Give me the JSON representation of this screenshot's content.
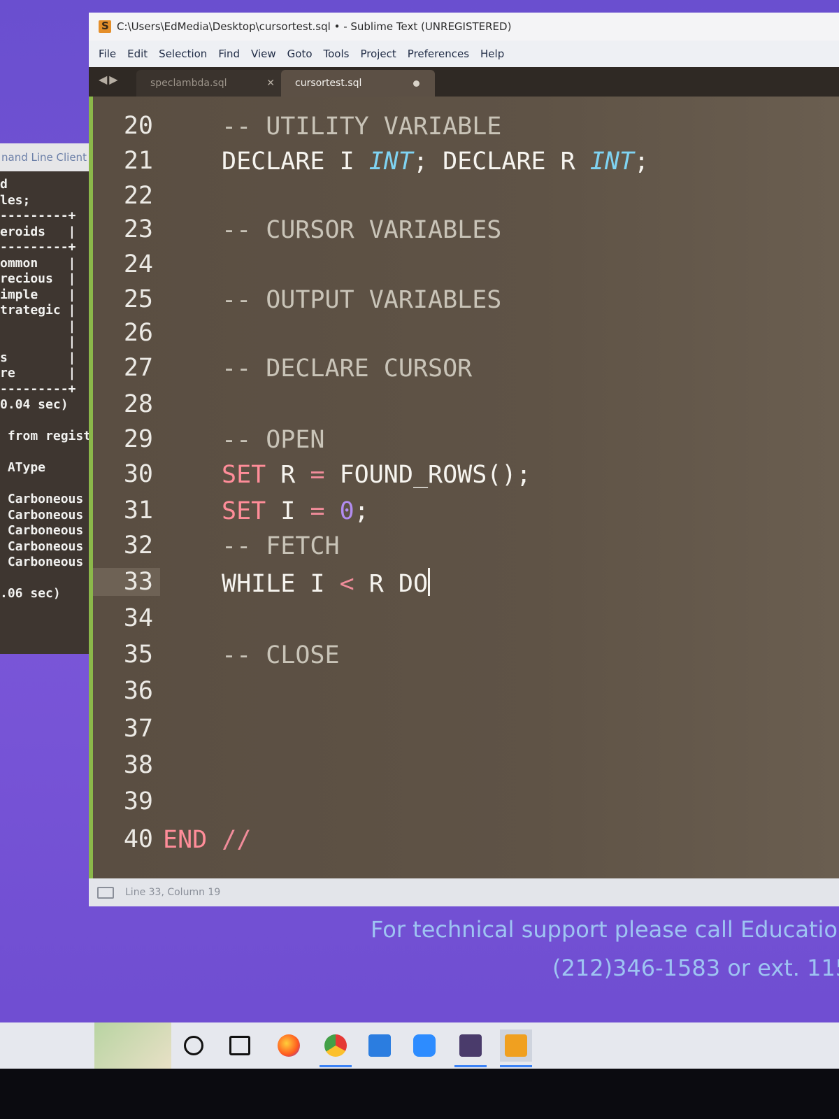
{
  "console": {
    "title": "nand Line Client",
    "lines": [
      "d",
      "les;",
      "---------+",
      "eroids   |",
      "---------+",
      "ommon    |",
      "recious  |",
      "imple    |",
      "trategic |",
      "         |",
      "         |",
      "s        |",
      "re       |",
      "---------+",
      "0.04 sec)",
      "",
      " from registr",
      "",
      " AType",
      "",
      " Carboneous",
      " Carboneous",
      " Carboneous",
      " Carboneous",
      " Carboneous",
      "",
      ".06 sec)"
    ]
  },
  "window": {
    "title": "C:\\Users\\EdMedia\\Desktop\\cursortest.sql • - Sublime Text (UNREGISTERED)",
    "menu": [
      "File",
      "Edit",
      "Selection",
      "Find",
      "View",
      "Goto",
      "Tools",
      "Project",
      "Preferences",
      "Help"
    ],
    "tabs": [
      {
        "label": "speclambda.sql",
        "active": false
      },
      {
        "label": "cursortest.sql",
        "active": true
      }
    ]
  },
  "editor": {
    "line_numbers": [
      "20",
      "21",
      "22",
      "23",
      "24",
      "25",
      "26",
      "27",
      "28",
      "29",
      "30",
      "31",
      "32",
      "33",
      "34",
      "35",
      "36",
      "37",
      "38",
      "39",
      "40"
    ],
    "active_line": "33",
    "lines": {
      "l20": "-- UTILITY VARIABLE",
      "l21_a": "DECLARE I ",
      "l21_b": "INT",
      "l21_c": "; DECLARE R ",
      "l21_d": "INT",
      "l21_e": ";",
      "l23": "-- CURSOR VARIABLES",
      "l25": "-- OUTPUT VARIABLES",
      "l27": "-- DECLARE CURSOR",
      "l29": "-- OPEN",
      "l30_a": "SET",
      "l30_b": " R ",
      "l30_c": "=",
      "l30_d": " FOUND_ROWS();",
      "l31_a": "SET",
      "l31_b": " I ",
      "l31_c": "=",
      "l31_d": " ",
      "l31_e": "0",
      "l31_f": ";",
      "l32": "-- FETCH",
      "l33_a": "WHILE I ",
      "l33_b": "<",
      "l33_c": " R DO",
      "l35": "-- CLOSE",
      "l40_a": "END",
      "l40_b": " //"
    }
  },
  "status": {
    "position": "Line 33, Column 19"
  },
  "support": {
    "line1": "For technical support please call Educatio",
    "line2": "(212)346-1583 or ext. 115"
  },
  "taskbar": {
    "icons": [
      "search-icon",
      "task-view-icon",
      "firefox-icon",
      "chrome-icon",
      "remote-desktop-icon",
      "zoom-icon",
      "media-app-icon",
      "sublime-text-icon"
    ]
  },
  "colors": {
    "accent": "#8bb84a",
    "keyword": "#ff8d99",
    "type": "#7fd3f2",
    "number": "#b28cf0"
  }
}
